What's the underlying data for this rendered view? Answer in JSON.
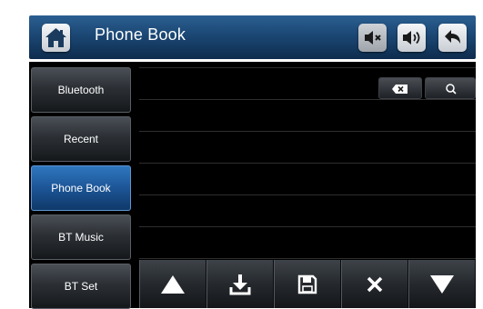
{
  "header": {
    "title": "Phone Book",
    "icons": [
      "home-icon",
      "mute-icon",
      "volume-icon",
      "back-icon"
    ]
  },
  "sidebar": {
    "items": [
      {
        "label": "Bluetooth",
        "active": false
      },
      {
        "label": "Recent",
        "active": false
      },
      {
        "label": "Phone Book",
        "active": true
      },
      {
        "label": "BT Music",
        "active": false
      },
      {
        "label": "BT Set",
        "active": false
      }
    ]
  },
  "list": {
    "rows": [
      "",
      "",
      "",
      "",
      "",
      ""
    ],
    "icons": [
      "backspace-icon",
      "search-icon"
    ]
  },
  "toolbar": {
    "icons": [
      "arrow-up-icon",
      "download-icon",
      "save-icon",
      "close-icon",
      "arrow-down-icon"
    ]
  },
  "colors": {
    "accent": "#1c5596",
    "header": "#1b4774",
    "background": "#000000"
  }
}
